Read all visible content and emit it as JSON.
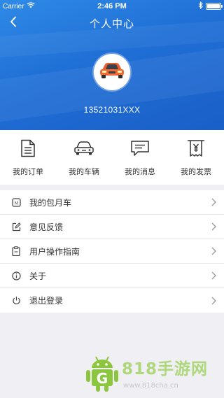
{
  "status_bar": {
    "carrier": "Carrier",
    "time": "2:46 PM",
    "battery_level": 1.0
  },
  "nav": {
    "title": "个人中心",
    "back_icon": "chevron-left-icon"
  },
  "profile": {
    "avatar_icon": "car-avatar-icon",
    "phone": "13521031XXX"
  },
  "quick_menu": [
    {
      "label": "我的订单",
      "icon": "document-icon"
    },
    {
      "label": "我的车辆",
      "icon": "car-icon"
    },
    {
      "label": "我的消息",
      "icon": "message-icon"
    },
    {
      "label": "我的发票",
      "icon": "invoice-icon"
    }
  ],
  "list": [
    {
      "label": "我的包月车",
      "icon": "monthly-card-icon"
    },
    {
      "label": "意见反馈",
      "icon": "edit-icon"
    },
    {
      "label": "用户操作指南",
      "icon": "clipboard-icon"
    },
    {
      "label": "关于",
      "icon": "info-icon"
    },
    {
      "label": "退出登录",
      "icon": "power-icon"
    }
  ],
  "watermark": {
    "title": "818手游网",
    "url": "www.818cha.cn"
  },
  "colors": {
    "header": "#1f6fd6",
    "icon": "#333333",
    "text": "#333333",
    "background": "#efeff4"
  }
}
